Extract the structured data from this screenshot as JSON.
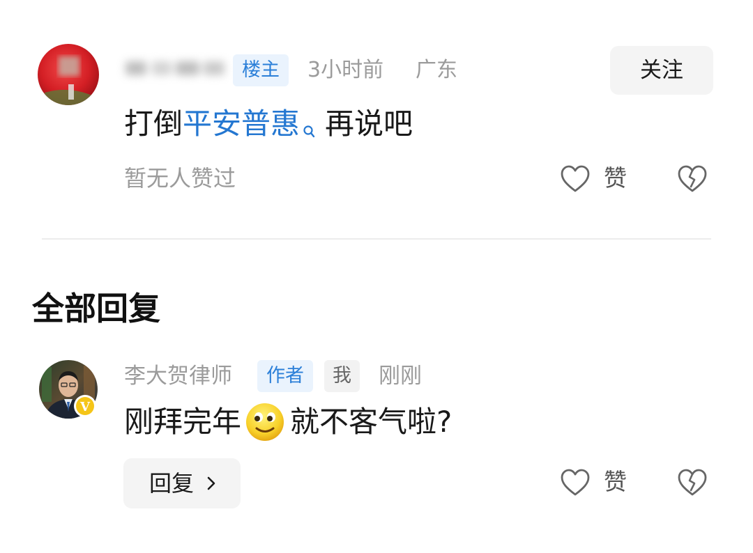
{
  "comment": {
    "author_name": "黄••••",
    "owner_badge": "楼主",
    "time": "3小时前",
    "region": "广东",
    "follow_label": "关注",
    "text_before": "打倒",
    "link_text": "平安普惠",
    "text_after": "再说吧",
    "no_likes_text": "暂无人赞过",
    "like_label": "赞"
  },
  "replies_section": {
    "title": "全部回复"
  },
  "reply": {
    "author_name": "李大贺律师",
    "author_badge": "作者",
    "me_badge": "我",
    "time": "刚刚",
    "text_before": "刚拜完年",
    "text_after": "就不客气啦?",
    "reply_label": "回复",
    "like_label": "赞",
    "verified_mark": "V"
  },
  "colors": {
    "link": "#2477d1",
    "badge_blue": "#2b7fd8",
    "badge_bg": "#eaf3fd",
    "muted_text": "#9b9b9b",
    "button_bg": "#f4f4f4",
    "verified_badge": "#f5c518"
  },
  "icons": {
    "like": "heart-outline-icon",
    "dislike": "broken-heart-icon",
    "search": "search-icon",
    "reply_arrow": "chevron-right-icon",
    "emoji": "smiling-face-emoji"
  }
}
